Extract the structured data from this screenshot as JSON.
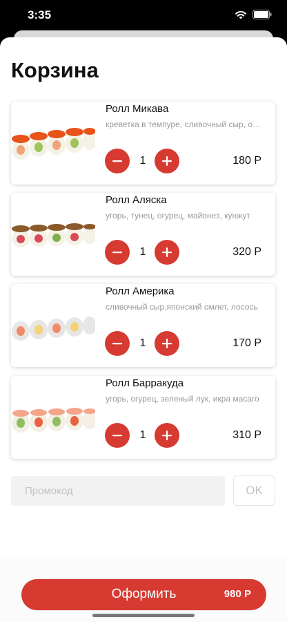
{
  "status_bar": {
    "time": "3:35",
    "icons": [
      "wifi-icon",
      "battery-icon"
    ]
  },
  "page": {
    "title": "Корзина"
  },
  "cart": {
    "items": [
      {
        "name": "Ролл Микава",
        "description": "креветка в темпуре, сливочный сыр, огурец",
        "quantity": "1",
        "price": "180 Р"
      },
      {
        "name": "Ролл Аляска",
        "description": "угорь, тунец, огурец, майонез, кунжут",
        "quantity": "1",
        "price": "320 Р"
      },
      {
        "name": "Ролл Америка",
        "description": "сливочный сыр,японский омлет, лосось",
        "quantity": "1",
        "price": "170 Р"
      },
      {
        "name": "Ролл Барракуда",
        "description": "угорь, огурец, зеленый лук, икра масаго",
        "quantity": "1",
        "price": "310 Р"
      }
    ]
  },
  "promo": {
    "placeholder": "Промокод",
    "ok_label": "OK"
  },
  "checkout": {
    "label": "Оформить",
    "total": "980 Р"
  },
  "colors": {
    "accent": "#d63a31"
  }
}
